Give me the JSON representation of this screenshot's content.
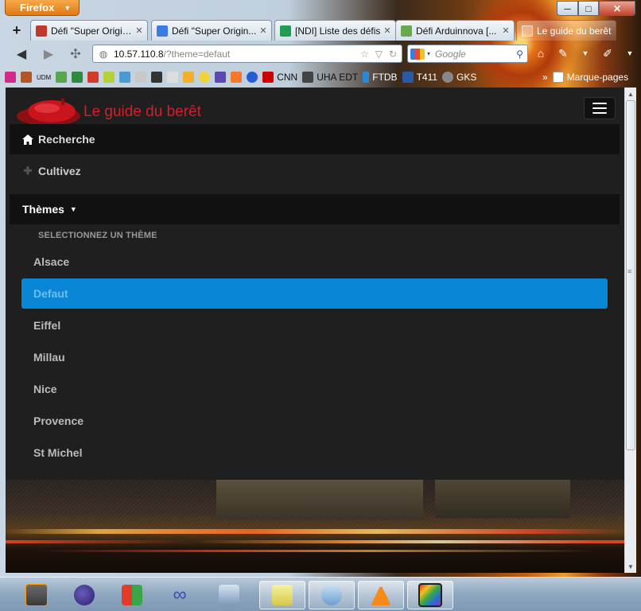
{
  "browser": {
    "menu_button": "Firefox",
    "window_controls": {
      "minimize": "─",
      "maximize": "□",
      "close": "✕"
    },
    "new_tab": "+",
    "tabs": [
      {
        "label": "Défi \"Super Origin...",
        "close": "✕",
        "active": false
      },
      {
        "label": "Défi \"Super Origin...",
        "close": "✕",
        "active": false
      },
      {
        "label": "[NDI] Liste des défis",
        "close": "✕",
        "active": false
      },
      {
        "label": "Défi Arduinnova [...",
        "close": "✕",
        "active": false
      },
      {
        "label": "Le guide du berêt",
        "close": "",
        "active": true
      }
    ],
    "url": {
      "host": "10.57.110.8",
      "path": "/?theme=defaut"
    },
    "search": {
      "placeholder": "Google"
    },
    "bookmarks": [
      {
        "label": "",
        "icon": "flower-icon",
        "color": "#d12b8a"
      },
      {
        "label": "",
        "icon": "jar-icon",
        "color": "#b2552a"
      },
      {
        "label": "UDM",
        "icon": "",
        "color": ""
      },
      {
        "label": "",
        "icon": "photo-icon",
        "color": "#5aa650"
      },
      {
        "label": "",
        "icon": "ca-icon",
        "color": "#2f8a3f"
      },
      {
        "label": "",
        "icon": "gmail-icon",
        "color": "#d23b2a"
      },
      {
        "label": "",
        "icon": "n-icon",
        "color": "#b5d13a"
      },
      {
        "label": "",
        "icon": "puzzle-icon",
        "color": "#4a9ad6"
      },
      {
        "label": "",
        "icon": "calendar-icon",
        "color": "#c8c8c8"
      },
      {
        "label": "",
        "icon": "nine-icon",
        "color": "#333333"
      },
      {
        "label": "",
        "icon": "cloud-icon",
        "color": "#ddd"
      },
      {
        "label": "",
        "icon": "in-icon",
        "color": "#f2b02a"
      },
      {
        "label": "",
        "icon": "smile-icon",
        "color": "#f2d23a"
      },
      {
        "label": "",
        "icon": "r-icon",
        "color": "#5a4ab0"
      },
      {
        "label": "",
        "icon": "bubble-icon",
        "color": "#f27a2a"
      },
      {
        "label": "",
        "icon": "firefox-icon",
        "color": "#2a5ad6"
      },
      {
        "label": "CNN",
        "icon": "cnn-icon",
        "color": "#cc0000"
      },
      {
        "label": "UHA EDT",
        "icon": "grid-icon",
        "color": "#444"
      },
      {
        "label": "FTDB",
        "icon": "bottle-icon",
        "color": "#2a8ad6"
      },
      {
        "label": "T411",
        "icon": "t-icon",
        "color": "#2a5aa6"
      },
      {
        "label": "GKS",
        "icon": "gks-icon",
        "color": "#888"
      }
    ],
    "bookmarks_overflow": "»",
    "bookmarks_menu": "Marque-pages"
  },
  "site": {
    "brand_name": "Le guide du berêt",
    "nav": {
      "recherche": "Recherche",
      "cultivez": "Cultivez",
      "themes": "Thèmes"
    },
    "dropdown_header": "SELECTIONNEZ UN THÈME",
    "themes": [
      {
        "label": "Alsace",
        "active": false
      },
      {
        "label": "Defaut",
        "active": true
      },
      {
        "label": "Eiffel",
        "active": false
      },
      {
        "label": "Millau",
        "active": false
      },
      {
        "label": "Nice",
        "active": false
      },
      {
        "label": "Provence",
        "active": false
      },
      {
        "label": "St Michel",
        "active": false
      }
    ],
    "accent_color": "#0a86d6",
    "brand_color": "#d21f2a"
  },
  "taskbar": {
    "apps": [
      {
        "icon": "sublime-icon",
        "open": false
      },
      {
        "icon": "eclipse-icon",
        "open": false
      },
      {
        "icon": "windows-icon",
        "open": false
      },
      {
        "icon": "infinity-icon",
        "open": false
      },
      {
        "icon": "virtualbox-icon",
        "open": false
      },
      {
        "icon": "notes-icon",
        "open": true
      },
      {
        "icon": "finder-icon",
        "open": true
      },
      {
        "icon": "vlc-icon",
        "open": true
      },
      {
        "icon": "filmstrip-icon",
        "open": true
      }
    ]
  }
}
